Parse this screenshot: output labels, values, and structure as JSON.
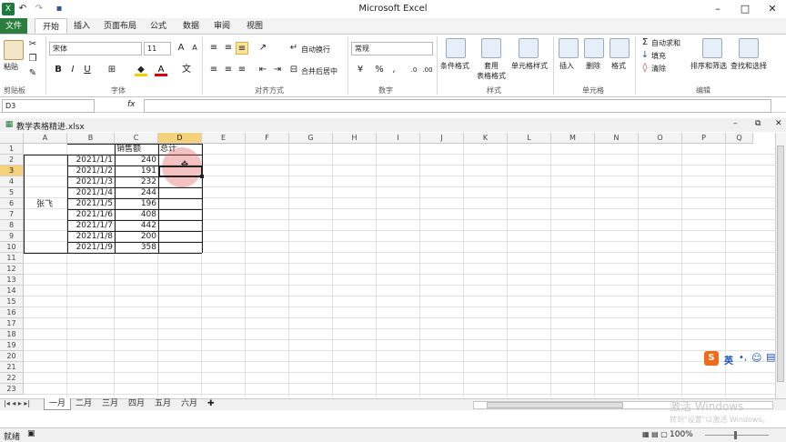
{
  "title": "Microsoft Excel",
  "tabs": [
    "文件",
    "开始",
    "插入",
    "页面布局",
    "公式",
    "数据",
    "审阅",
    "视图"
  ],
  "ribbon": {
    "paste": "粘贴",
    "font_name": "宋体",
    "font_size": "11",
    "wrap": "自动换行",
    "merge": "合并后居中",
    "number_format": "常规",
    "cond_format": "条件格式",
    "table_format": "套用\n表格格式",
    "cell_style": "单元格样式",
    "insert": "插入",
    "delete": "删除",
    "format": "格式",
    "autosum": "自动求和",
    "fill": "填充",
    "clear": "清除",
    "sort_filter": "排序和筛选",
    "find_select": "查找和选择",
    "groups": [
      "剪贴板",
      "字体",
      "对齐方式",
      "数字",
      "样式",
      "单元格",
      "编辑"
    ]
  },
  "formula": {
    "name_box": "D3",
    "fx": "fx",
    "content": ""
  },
  "workbook": {
    "name": "教学表格精进.xlsx"
  },
  "columns": [
    "A",
    "B",
    "C",
    "D",
    "E",
    "F",
    "G",
    "H",
    "I",
    "J",
    "K",
    "L",
    "M",
    "N",
    "O",
    "P",
    "Q"
  ],
  "rows": [
    "1",
    "2",
    "3",
    "4",
    "5",
    "6",
    "7",
    "8",
    "9",
    "10",
    "11",
    "12",
    "13",
    "14",
    "15",
    "16",
    "17",
    "18",
    "19",
    "20",
    "21",
    "22",
    "23"
  ],
  "table": {
    "header_c": "销售额",
    "header_d": "总计",
    "name": "张飞",
    "dates": [
      "2021/1/1",
      "2021/1/2",
      "2021/1/3",
      "2021/1/4",
      "2021/1/5",
      "2021/1/6",
      "2021/1/7",
      "2021/1/8",
      "2021/1/9"
    ],
    "values": [
      "240",
      "191",
      "232",
      "244",
      "196",
      "408",
      "442",
      "200",
      "358"
    ]
  },
  "sheets": [
    "一月",
    "二月",
    "三月",
    "四月",
    "五月",
    "六月"
  ],
  "status": {
    "ready": "就绪",
    "zoom": "100%"
  },
  "ime": {
    "lang": "英"
  },
  "watermark": {
    "line1": "激活 Windows",
    "line2": "转到\"设置\"以激活 Windows。"
  }
}
